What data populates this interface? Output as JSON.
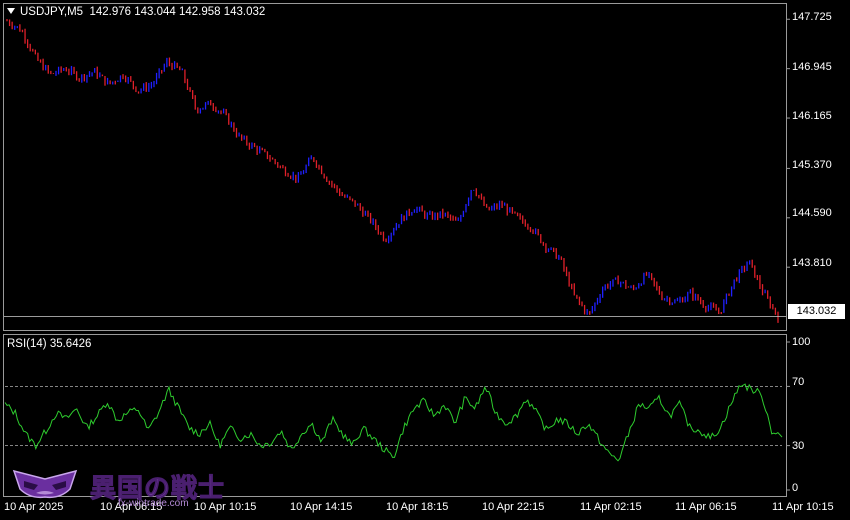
{
  "header": {
    "symbol": "USDJPY,M5",
    "ohlc": "142.976 143.044 142.958 143.032"
  },
  "price_axis": [
    "147.725",
    "146.945",
    "146.165",
    "145.370",
    "144.590",
    "143.810"
  ],
  "current_price": "143.032",
  "rsi": {
    "label": "RSI(14) 35.6426",
    "axis": [
      "100",
      "70",
      "30",
      "0"
    ]
  },
  "time_axis": [
    "10 Apr 2025",
    "10 Apr 06:15",
    "10 Apr 10:15",
    "10 Apr 14:15",
    "10 Apr 18:15",
    "10 Apr 22:15",
    "11 Apr 02:15",
    "11 Apr 06:15",
    "11 Apr 10:15"
  ],
  "watermark": {
    "text": "異国の戦士",
    "url": "fx-wintrade.com"
  },
  "colors": {
    "bull": "#2020ff",
    "bear": "#e0202a",
    "rsi_line": "#2ecc2e",
    "level": "#b0b0b0"
  },
  "chart_data": [
    {
      "type": "candlestick",
      "title": "USDJPY,M5",
      "ylim": [
        142.85,
        147.95
      ],
      "x": [
        "10 Apr 2025",
        "10 Apr 06:15",
        "10 Apr 10:15",
        "10 Apr 14:15",
        "10 Apr 18:15",
        "10 Apr 22:15",
        "11 Apr 02:15",
        "11 Apr 06:15",
        "11 Apr 10:15"
      ],
      "path": [
        147.7,
        147.55,
        147.1,
        146.85,
        146.95,
        146.8,
        146.9,
        146.7,
        146.85,
        146.6,
        146.7,
        147.05,
        146.9,
        146.3,
        146.4,
        146.2,
        145.85,
        145.7,
        145.55,
        145.35,
        145.2,
        145.55,
        145.2,
        144.95,
        144.8,
        144.55,
        144.25,
        144.55,
        144.75,
        144.6,
        144.65,
        144.5,
        145.1,
        144.7,
        144.8,
        144.6,
        144.45,
        144.15,
        143.95,
        143.35,
        143.05,
        143.5,
        143.6,
        143.45,
        143.7,
        143.35,
        143.25,
        143.4,
        143.2,
        143.1,
        143.6,
        143.9,
        143.4,
        143.03
      ]
    },
    {
      "type": "line",
      "title": "RSI(14) 35.6426",
      "ylim": [
        0,
        100
      ],
      "levels": [
        70,
        30
      ],
      "path": [
        58,
        52,
        38,
        30,
        40,
        52,
        48,
        55,
        42,
        50,
        60,
        47,
        52,
        55,
        40,
        52,
        68,
        55,
        42,
        38,
        45,
        30,
        42,
        35,
        38,
        30,
        32,
        40,
        27,
        38,
        45,
        32,
        48,
        38,
        30,
        42,
        35,
        28,
        22,
        42,
        55,
        60,
        50,
        58,
        45,
        62,
        55,
        70,
        52,
        45,
        50,
        62,
        52,
        40,
        48,
        45,
        38,
        45,
        35,
        25,
        20,
        38,
        58,
        55,
        62,
        50,
        58,
        42,
        40,
        35,
        42,
        58,
        72,
        68,
        65,
        40,
        36
      ]
    }
  ]
}
